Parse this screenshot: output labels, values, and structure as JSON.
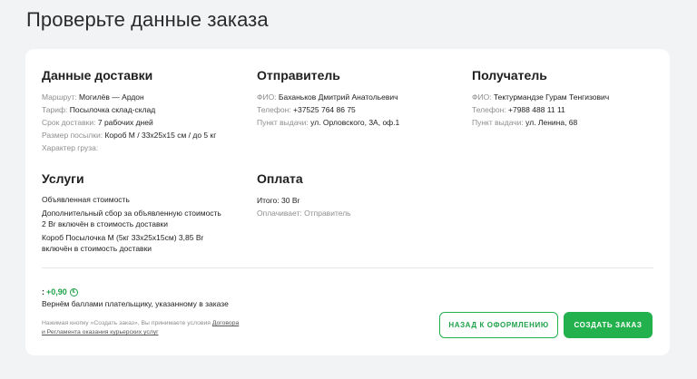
{
  "page_title": "Проверьте данные заказа",
  "delivery": {
    "title": "Данные доставки",
    "rows": [
      {
        "label": "Маршрут:",
        "value": "Могилёв — Ардон"
      },
      {
        "label": "Тариф:",
        "value": "Посылочка склад-склад"
      },
      {
        "label": "Срок доставки:",
        "value": "7 рабочих дней"
      },
      {
        "label": "Размер посылки:",
        "value": "Короб М / 33x25x15 см / до 5 кг"
      },
      {
        "label": "Характер груза:",
        "value": ""
      }
    ]
  },
  "sender": {
    "title": "Отправитель",
    "rows": [
      {
        "label": "ФИО:",
        "value": "Баханьков Дмитрий Анатольевич"
      },
      {
        "label": "Телефон:",
        "value": "+37525 764 86 75"
      },
      {
        "label": "Пункт выдачи:",
        "value": "ул. Орловского, 3А, оф.1"
      }
    ]
  },
  "recipient": {
    "title": "Получатель",
    "rows": [
      {
        "label": "ФИО:",
        "value": "Тектурмандзе Гурам Тенгизович"
      },
      {
        "label": "Телефон:",
        "value": "+7988 488 11 11"
      },
      {
        "label": "Пункт выдачи:",
        "value": "ул. Ленина, 68"
      }
    ]
  },
  "services": {
    "title": "Услуги",
    "lines": [
      "Объявленная стоимость",
      "Дополнительный сбор за объявленную стоимость",
      "2 Br включён в стоимость доставки",
      "Короб Посылочка М (5кг 33x25x15см) 3,85 Br",
      "включён в стоимость доставки"
    ]
  },
  "payment": {
    "title": "Оплата",
    "total_label": "Итого:",
    "total_value": "30 Br",
    "payer_label": "Оплачивает:",
    "payer_value": "Отправитель"
  },
  "bonus": {
    "prefix": ":",
    "value": "+0,90",
    "coin": "€",
    "note": "Вернём баллами плательщику, указанному в заказе"
  },
  "legal": {
    "text1": "Нажимая кнопку «Создать заказ», Вы принимаете условия ",
    "link1": "Договора",
    "link2": "и Регламента оказания курьерских услуг"
  },
  "buttons": {
    "back": "НАЗАД К ОФОРМЛЕНИЮ",
    "create": "СОЗДАТЬ ЗАКАЗ"
  },
  "colors": {
    "accent": "#22b14c",
    "muted": "#8e8e8e",
    "background": "#f2f3f5"
  }
}
